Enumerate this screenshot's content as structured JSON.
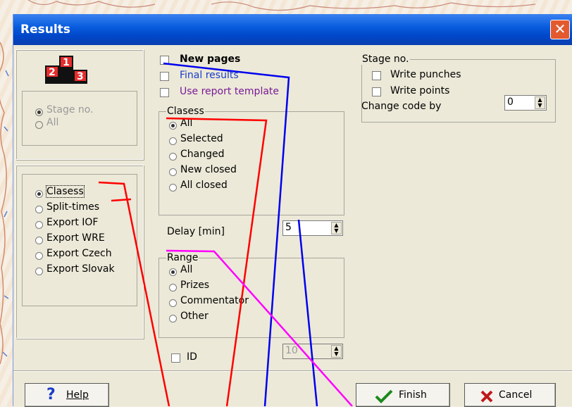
{
  "window": {
    "title": "Results",
    "close_glyph": "✕"
  },
  "logo": {
    "digits": [
      "1",
      "2",
      "3"
    ]
  },
  "stage_panel": {
    "options": [
      {
        "label": "Stage no.",
        "checked": true
      },
      {
        "label": "All",
        "checked": false
      }
    ]
  },
  "type_panel": {
    "options": [
      {
        "label": "Clasess",
        "checked": true
      },
      {
        "label": "Split-times",
        "checked": false
      },
      {
        "label": "Export IOF",
        "checked": false
      },
      {
        "label": "Export WRE",
        "checked": false
      },
      {
        "label": "Export Czech",
        "checked": false
      },
      {
        "label": "Export Slovak",
        "checked": false
      }
    ]
  },
  "options": {
    "new_pages": "New pages",
    "final_results": "Final results",
    "use_report_template": "Use report template"
  },
  "classes_group": {
    "title": "Clasess",
    "options": [
      {
        "label": "All",
        "checked": true
      },
      {
        "label": "Selected",
        "checked": false
      },
      {
        "label": "Changed",
        "checked": false
      },
      {
        "label": "New closed",
        "checked": false
      },
      {
        "label": "All closed",
        "checked": false
      }
    ]
  },
  "delay": {
    "label": "Delay [min]",
    "value": "5"
  },
  "range_group": {
    "title": "Range",
    "options": [
      {
        "label": "All",
        "checked": true
      },
      {
        "label": "Prizes",
        "checked": false
      },
      {
        "label": "Commentator",
        "checked": false
      },
      {
        "label": "Other",
        "checked": false
      }
    ]
  },
  "id_field": {
    "label": "ID",
    "value": "10"
  },
  "stage_group": {
    "title": "Stage no.",
    "write_punches": "Write punches",
    "write_points": "Write points",
    "change_code_label": "Change code by",
    "change_code_value": "0"
  },
  "buttons": {
    "help": "Help",
    "finish": "Finish",
    "cancel": "Cancel"
  },
  "colors": {
    "titlebar": "#0a5ddf",
    "annotation_red": "#ff0000",
    "annotation_blue": "#0000ee",
    "annotation_magenta": "#ff00ff"
  }
}
